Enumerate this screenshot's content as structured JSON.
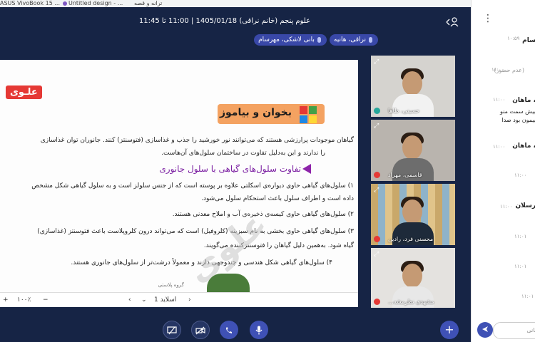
{
  "bookmarks": {
    "items": [
      {
        "label": "ASUS VivoBook 15 ...",
        "icon": "bookmark-icon"
      },
      {
        "label": "Untitled design - ...",
        "icon": "canva-icon"
      },
      {
        "label": "ترانه و قصه",
        "icon": "folder-icon"
      }
    ]
  },
  "meeting": {
    "title": "علوم پنجم (خانم نراقی) 1405/01/18 | 11:00 تا 11:45",
    "speaking": [
      {
        "label": "نراقی، هانیه"
      },
      {
        "label": "بانی لاشکی، مهرسام"
      }
    ]
  },
  "slide": {
    "logo": "علـوی",
    "banner": "بخوان و بیاموز",
    "intro_1": "گیاهان موجودات پرارزشی هستند که می‌توانند نور خورشید را جذب و غذاسازی (فتوسنتز) کنند. جانوران توان غذاسازی",
    "intro_2": "را ندارند و این به‌دلیل تفاوت در ساختمان سلول‌های آن‌هاست.",
    "subheading": "تفاوت سلول‌های گیاهی با سلول جانوری",
    "point_1a": "۱) سلول‌های گیاهی حاوی دیواره‌ی اسکلتی علاوه بر پوسته است که از جنس سلولز است و به سلول گیاهی شکل مشخص",
    "point_1b": "داده است و اطراف سلول باعث استحکام سلول می‌شود.",
    "point_2": "۲) سلول‌های گیاهی حاوی کیسه‌ی ذخیره‌ی آب و املاح معدنی هستند.",
    "point_3a": "۳) سلول‌های گیاهی حاوی بخشی به نام سبزینه (کلروفیل) است که می‌تواند درون کلروپلاست باعث فتوسنتز (غذاسازی)",
    "point_3b": "گیاه شود. به‌همین دلیل گیاهان را فتوسنتزکننده می‌گویند.",
    "point_4": "۴) سلول‌های گیاهی شکل هندسی و چندوجهی دارند و معمولاً درشت‌تر از سلول‌های جانوری هستند.",
    "watermark": "علوی",
    "footer_note": "گروه پلاستی"
  },
  "slide_controls": {
    "zoom": "۱۰۰٪",
    "zoom_in": "+",
    "zoom_out": "−",
    "page_label": "اسلاید 1",
    "prev": "‹",
    "next": "›",
    "dropdown": "⌄"
  },
  "participants": [
    {
      "name": "حسینی، طاها",
      "mic": "on",
      "bg": "#d5d3cf",
      "shirt": "#f2f2f2"
    },
    {
      "name": "قاسمی، مهراد",
      "mic": "off",
      "bg": "#b9b4ae",
      "shirt": "#6d6d6d"
    },
    {
      "name": "محسنی فرد، رادین",
      "mic": "off",
      "bg": "#c9a86a",
      "shirt": "#1e2a3a"
    },
    {
      "name": "مشهدی نظرمشه...",
      "mic": "off",
      "bg": "#e4e2df",
      "shirt": "#e8e8e8"
    }
  ],
  "chat": {
    "messages": [
      {
        "name": "سام",
        "time": "۱۰:۵۹",
        "text": ""
      },
      {
        "name": "",
        "time": "۱۱:۰۰",
        "text": "(عدم حضور)"
      },
      {
        "name": "، ماهان",
        "time": "۱۱:۰۰",
        "text": "بیش سمت منو"
      },
      {
        "name": "",
        "time": "",
        "text": "بیمون بود صدا"
      },
      {
        "name": "، ماهان",
        "time": "۱۱:۰۰",
        "text": ""
      },
      {
        "name": "",
        "time": "۱۱:۰۰",
        "text": ""
      },
      {
        "name": "رسلان",
        "time": "۱۱:۰۰",
        "text": ""
      },
      {
        "name": "",
        "time": "۱۱:۰۱",
        "text": ""
      },
      {
        "name": "",
        "time": "۱۱:۰۱",
        "text": ""
      },
      {
        "name": "",
        "time": "۱۱:۰۱",
        "text": ""
      }
    ],
    "input_placeholder": "به همگانی"
  },
  "colors": {
    "accent": "#3f51b5",
    "meeting_bg": "#162445",
    "mic_off": "#e53935",
    "mic_on": "#26a69a"
  }
}
